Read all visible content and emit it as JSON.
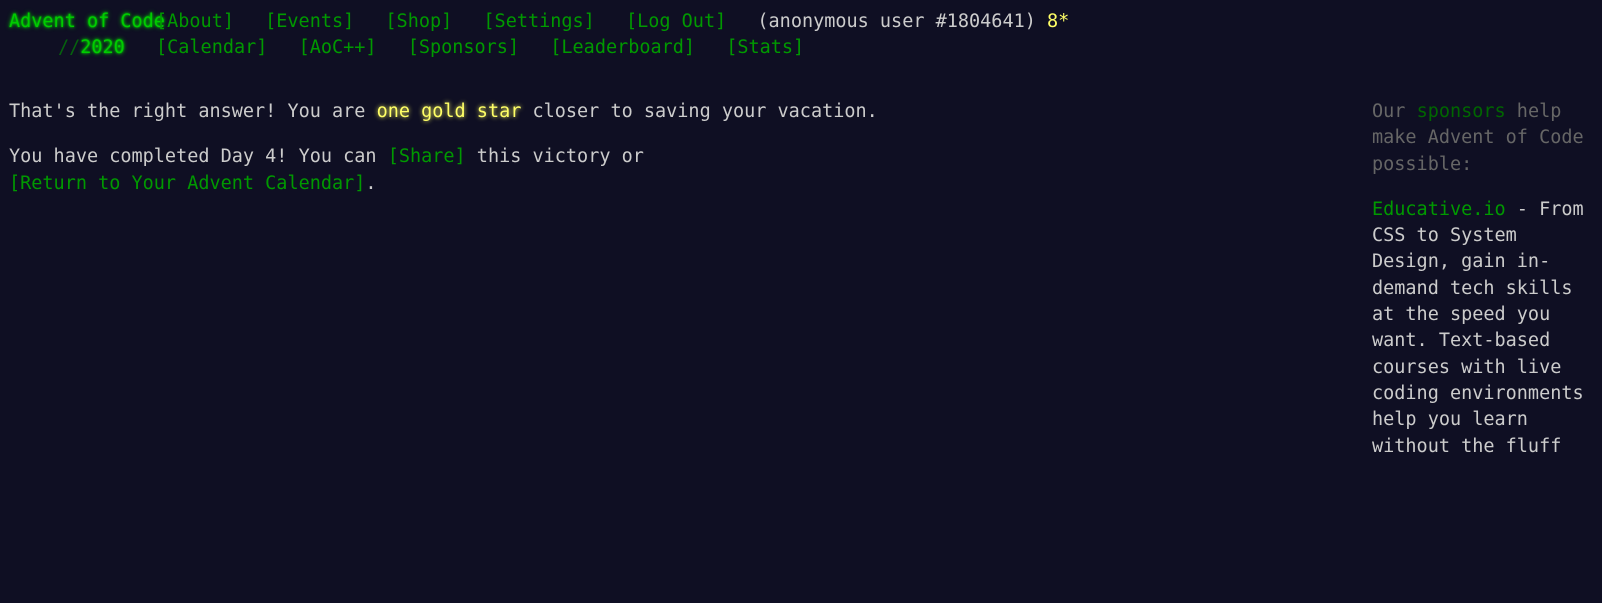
{
  "header": {
    "title": "Advent of Code",
    "nav_row1": [
      "[About]",
      "[Events]",
      "[Shop]",
      "[Settings]",
      "[Log Out]"
    ],
    "user": "(anonymous user #1804641)",
    "stars": "8*",
    "year_prefix": "//",
    "year": "2020",
    "nav_row2": [
      "[Calendar]",
      "[AoC++]",
      "[Sponsors]",
      "[Leaderboard]",
      "[Stats]"
    ]
  },
  "main": {
    "answer_text_before": "That's the right answer! You are ",
    "gold_star_text": "one gold star",
    "answer_text_after": " closer to saving your vacation.",
    "completed_text": "You have completed Day 4! You can ",
    "share_link": "[Share]",
    "victory_text": " this victory or ",
    "return_link": "[Return to Your Advent Calendar]",
    "period": "."
  },
  "sidebar": {
    "intro_before": "Our ",
    "sponsors_word": "sponsors",
    "intro_after": " help make Advent of Code possible:",
    "sponsor_name": "Educative.io",
    "sponsor_desc": " - From CSS to System Design, gain in-demand tech skills at the speed you want. Text-based courses with live coding environments help you learn without the fluff"
  },
  "colors": {
    "background": "#0f0f23",
    "text": "#cccccc",
    "link": "#009900",
    "title": "#00cc00",
    "gold": "#ffff66",
    "muted": "#666666"
  }
}
